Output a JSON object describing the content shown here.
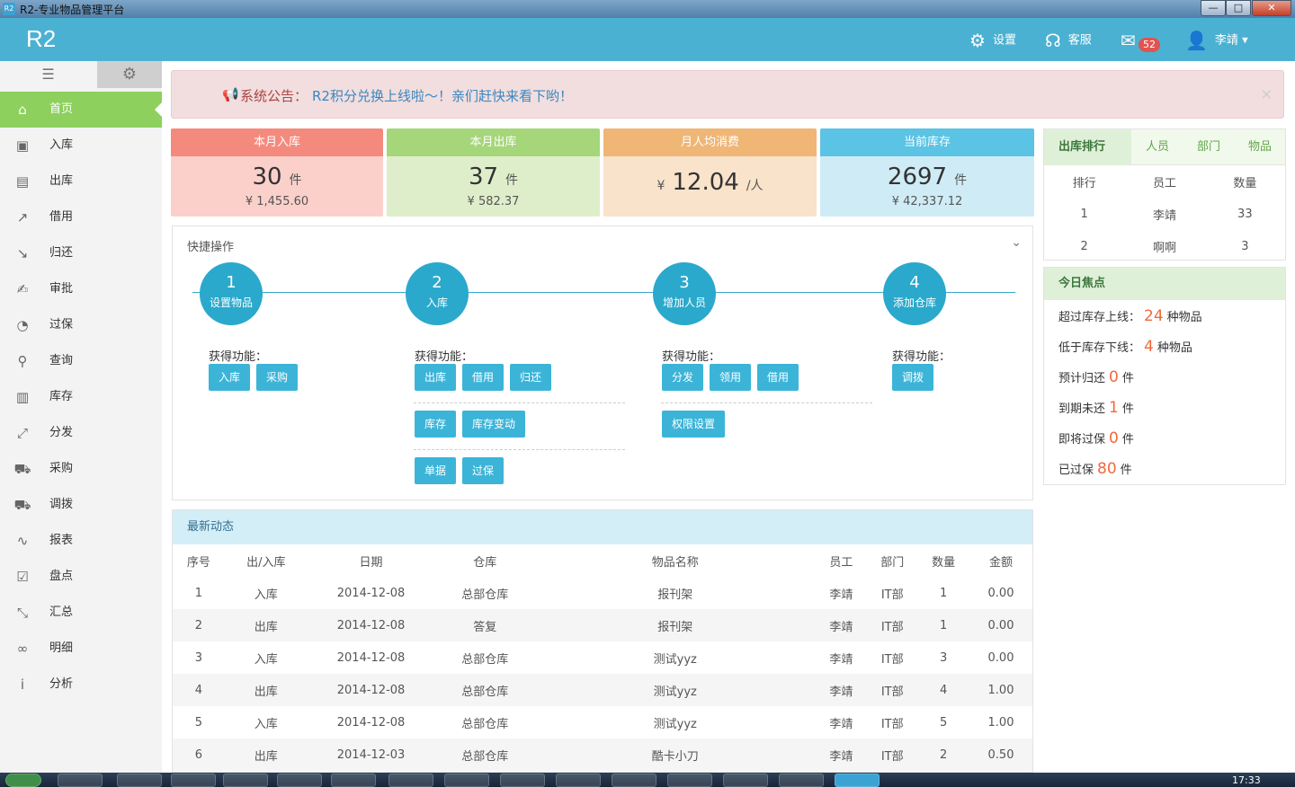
{
  "window": {
    "title": "R2-专业物品管理平台",
    "app_icon": "R2",
    "min": "—",
    "max": "□",
    "close": "✕"
  },
  "header": {
    "logo": "R2",
    "settings": "设置",
    "service": "客服",
    "mail_badge": "52",
    "user": "李靖"
  },
  "sidebar": {
    "items": [
      {
        "icon": "home-icon",
        "glyph": "⌂",
        "label": "首页"
      },
      {
        "icon": "box-icon",
        "glyph": "▣",
        "label": "入库"
      },
      {
        "icon": "boxes-icon",
        "glyph": "▤",
        "label": "出库"
      },
      {
        "icon": "borrow-icon",
        "glyph": "↗",
        "label": "借用"
      },
      {
        "icon": "return-icon",
        "glyph": "↘",
        "label": "归还"
      },
      {
        "icon": "approve-icon",
        "glyph": "✍",
        "label": "审批"
      },
      {
        "icon": "warranty-icon",
        "glyph": "◔",
        "label": "过保"
      },
      {
        "icon": "search-icon",
        "glyph": "⚲",
        "label": "查询"
      },
      {
        "icon": "inventory-icon",
        "glyph": "▥",
        "label": "库存"
      },
      {
        "icon": "distribute-icon",
        "glyph": "⤢",
        "label": "分发"
      },
      {
        "icon": "cart-icon",
        "glyph": "⛟",
        "label": "采购"
      },
      {
        "icon": "truck-icon",
        "glyph": "⛟",
        "label": "调拨"
      },
      {
        "icon": "chart-icon",
        "glyph": "∿",
        "label": "报表"
      },
      {
        "icon": "check-icon",
        "glyph": "☑",
        "label": "盘点"
      },
      {
        "icon": "summary-icon",
        "glyph": "⤡",
        "label": "汇总"
      },
      {
        "icon": "detail-icon",
        "glyph": "∞",
        "label": "明细"
      },
      {
        "icon": "analysis-icon",
        "glyph": "ⅰ",
        "label": "分析"
      }
    ]
  },
  "notice": {
    "prefix": "系统公告：",
    "text": "R2积分兑换上线啦～！亲们赶快来看下哟！",
    "close": "×"
  },
  "stats": [
    {
      "title": "本月入库",
      "value": "30",
      "unit": "件",
      "sub": "¥ 1,455.60",
      "head_color": "#f48a7d",
      "body_color": "#fbd0cb"
    },
    {
      "title": "本月出库",
      "value": "37",
      "unit": "件",
      "sub": "¥ 582.37",
      "head_color": "#a5d67a",
      "body_color": "#dfeeca"
    },
    {
      "title": "月人均消费",
      "value": "12.04",
      "unit": "/人",
      "sub": "",
      "head_color": "#efb676",
      "body_color": "#f9e3cb"
    },
    {
      "title": "当前库存",
      "value": "2697",
      "unit": "件",
      "sub": "¥ 42,337.12",
      "head_color": "#5bc3e3",
      "body_color": "#cfecf6"
    }
  ],
  "quick": {
    "title": "快捷操作",
    "gain_label": "获得功能：",
    "steps": [
      {
        "num": "1",
        "label": "设置物品",
        "buttons": [
          [
            "入库",
            "采购"
          ]
        ]
      },
      {
        "num": "2",
        "label": "入库",
        "buttons": [
          [
            "出库",
            "借用",
            "归还"
          ],
          [
            "库存",
            "库存变动"
          ],
          [
            "单据",
            "过保"
          ]
        ]
      },
      {
        "num": "3",
        "label": "增加人员",
        "buttons": [
          [
            "分发",
            "领用",
            "借用"
          ],
          [
            "权限设置"
          ]
        ]
      },
      {
        "num": "4",
        "label": "添加仓库",
        "buttons": [
          [
            "调拨"
          ]
        ]
      }
    ]
  },
  "recent": {
    "title": "最新动态",
    "headers": [
      "序号",
      "出/入库",
      "日期",
      "仓库",
      "物品名称",
      "员工",
      "部门",
      "数量",
      "金额"
    ],
    "rows": [
      [
        "1",
        "入库",
        "2014-12-08",
        "总部仓库",
        "报刊架",
        "李靖",
        "IT部",
        "1",
        "0.00"
      ],
      [
        "2",
        "出库",
        "2014-12-08",
        "答复",
        "报刊架",
        "李靖",
        "IT部",
        "1",
        "0.00"
      ],
      [
        "3",
        "入库",
        "2014-12-08",
        "总部仓库",
        "测试yyz",
        "李靖",
        "IT部",
        "3",
        "0.00"
      ],
      [
        "4",
        "出库",
        "2014-12-08",
        "总部仓库",
        "测试yyz",
        "李靖",
        "IT部",
        "4",
        "1.00"
      ],
      [
        "5",
        "入库",
        "2014-12-08",
        "总部仓库",
        "测试yyz",
        "李靖",
        "IT部",
        "5",
        "1.00"
      ],
      [
        "6",
        "出库",
        "2014-12-03",
        "总部仓库",
        "酷卡小刀",
        "李靖",
        "IT部",
        "2",
        "0.50"
      ]
    ]
  },
  "rank": {
    "tabs": [
      "出库排行",
      "人员",
      "部门",
      "物品"
    ],
    "headers": [
      "排行",
      "员工",
      "数量"
    ],
    "rows": [
      [
        "1",
        "李靖",
        "33"
      ],
      [
        "2",
        "啊啊",
        "3"
      ]
    ]
  },
  "focus": {
    "title": "今日焦点",
    "items": [
      {
        "pre": "超过库存上线：",
        "num": "24",
        "post": "种物品"
      },
      {
        "pre": "低于库存下线：",
        "num": "4",
        "post": "种物品"
      },
      {
        "pre": "预计归还",
        "num": "0",
        "post": "件"
      },
      {
        "pre": "到期未还",
        "num": "1",
        "post": "件"
      },
      {
        "pre": "即将过保",
        "num": "0",
        "post": "件"
      },
      {
        "pre": "已过保",
        "num": "80",
        "post": "件"
      }
    ]
  },
  "taskbar": {
    "clock": "17:33"
  }
}
